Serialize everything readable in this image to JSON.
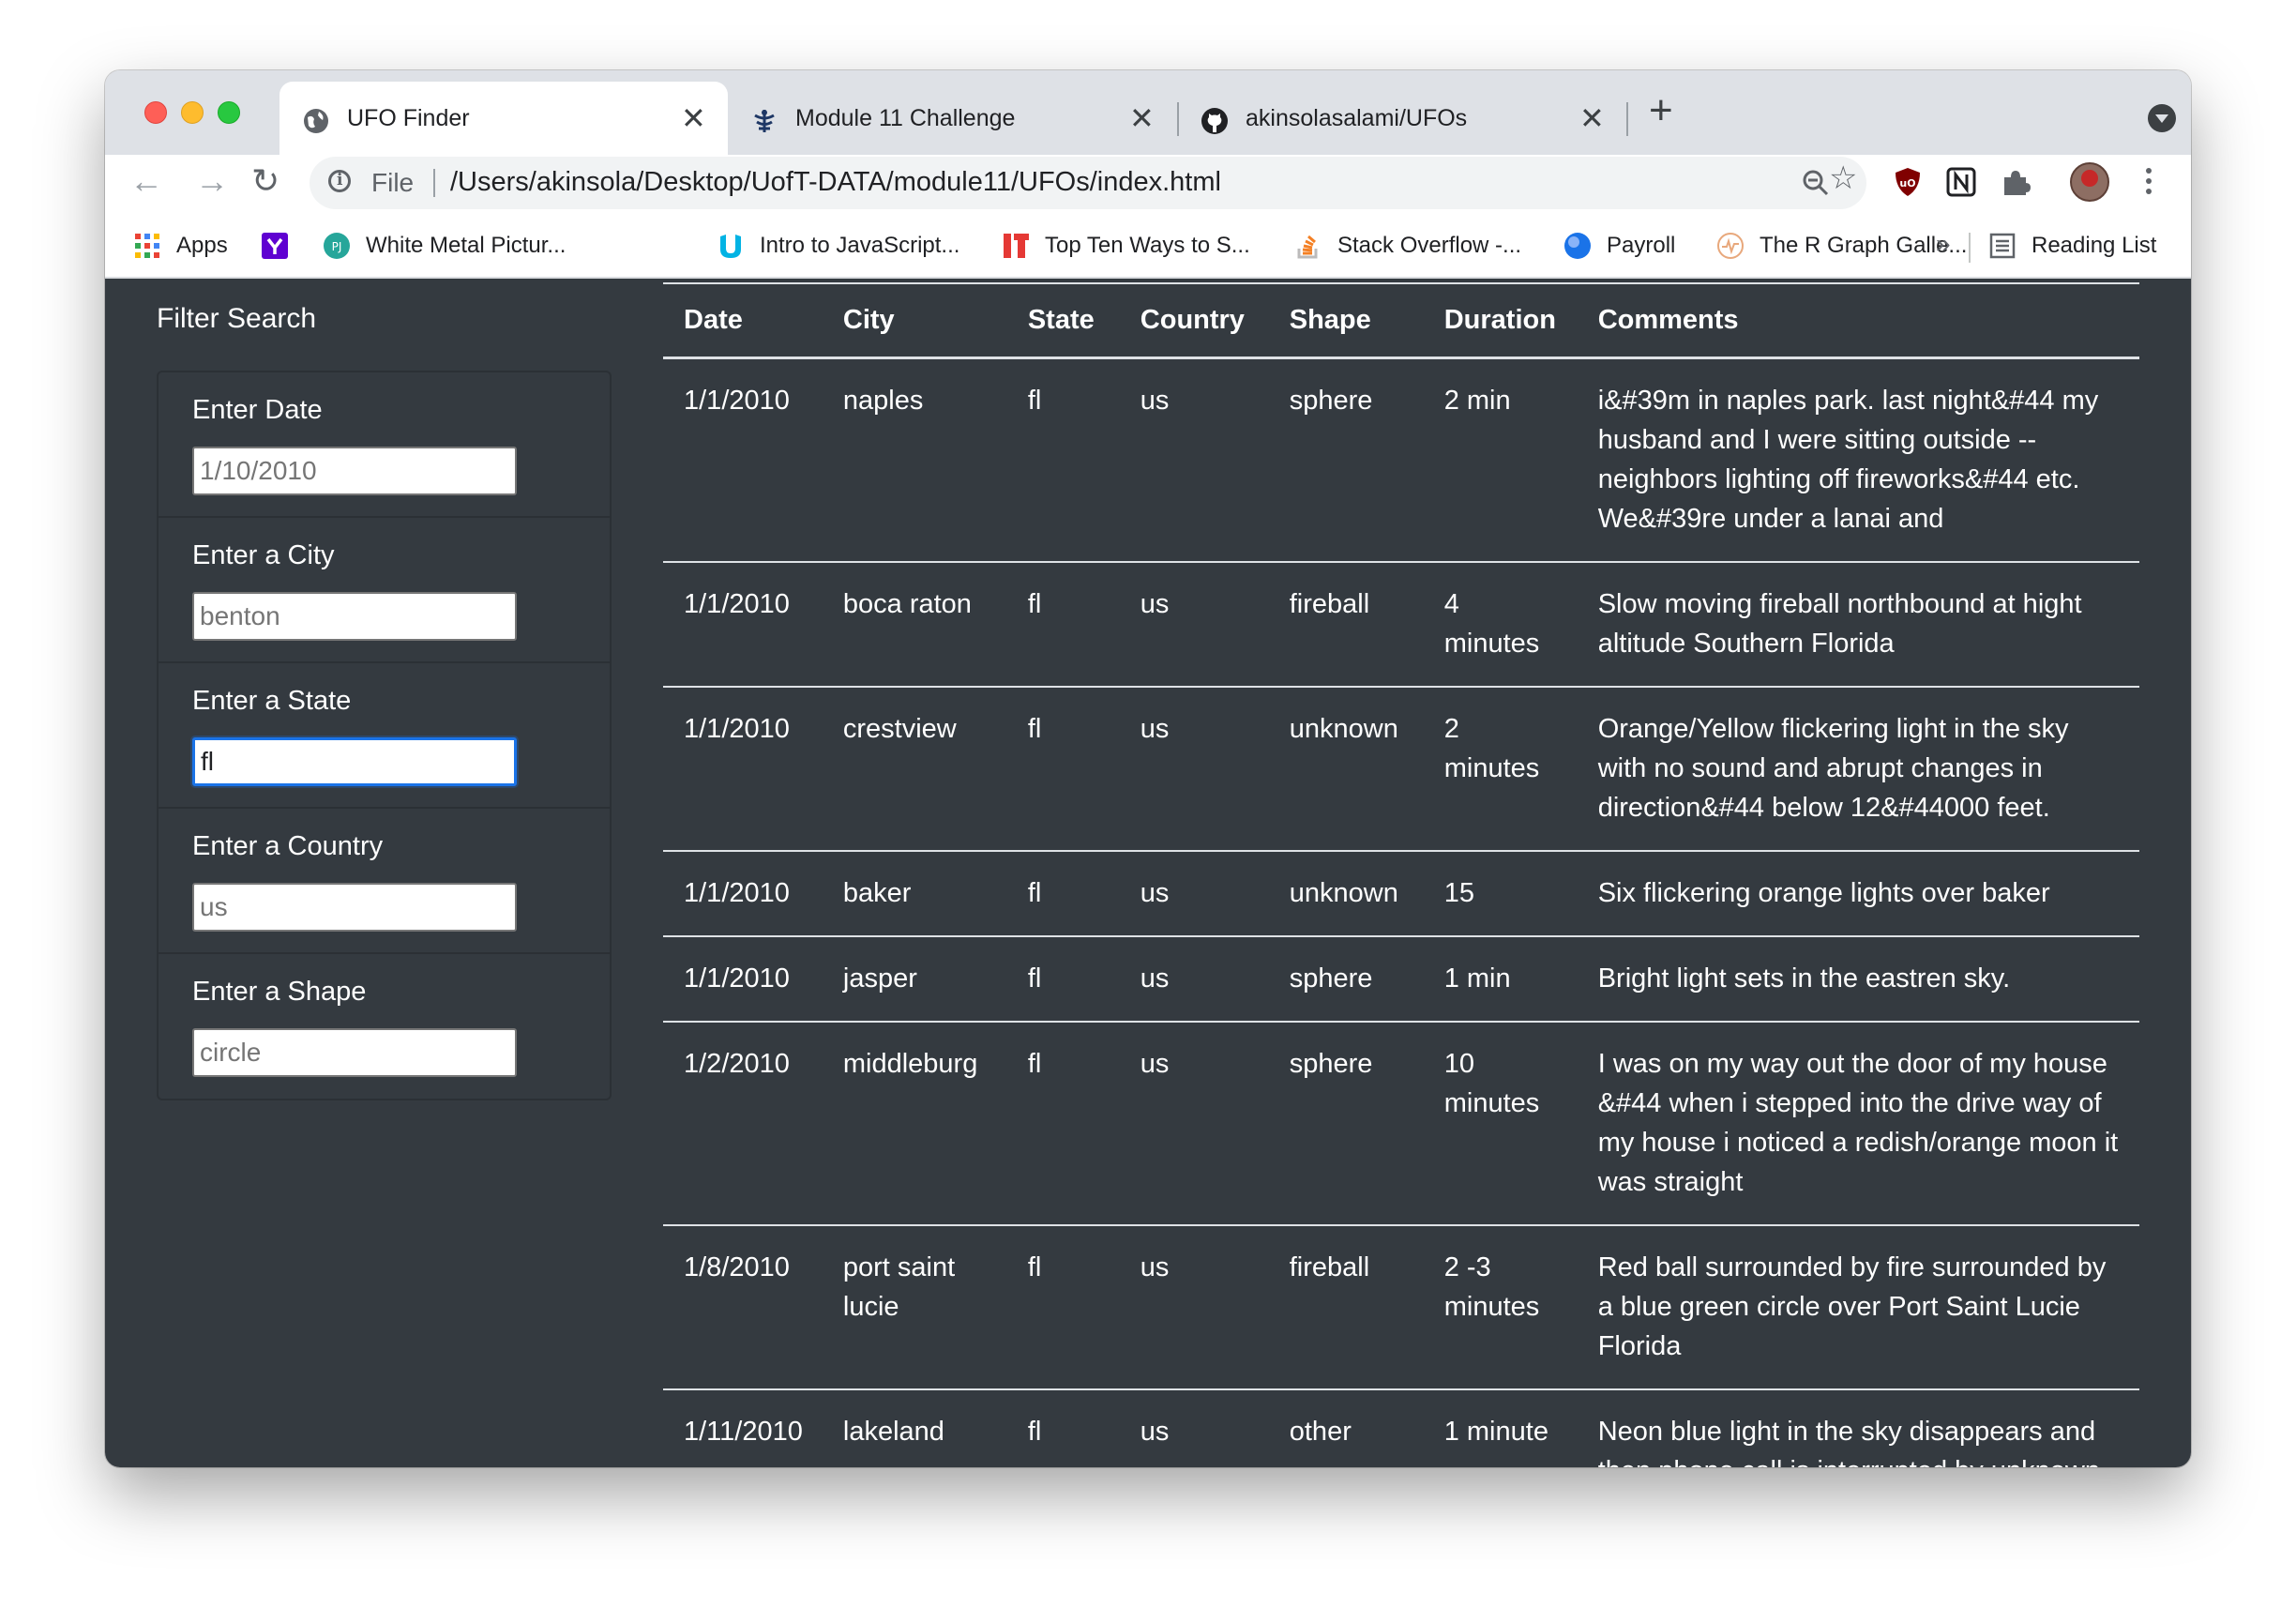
{
  "browser": {
    "tabs": [
      {
        "title": "UFO Finder",
        "icon": "globe-icon",
        "active": true
      },
      {
        "title": "Module 11 Challenge",
        "icon": "uoft-crest-icon",
        "active": false
      },
      {
        "title": "akinsolasalami/UFOs",
        "icon": "github-icon",
        "active": false
      }
    ],
    "address": {
      "scheme_label": "File",
      "url": "/Users/akinsola/Desktop/UofT-DATA/module11/UFOs/index.html"
    },
    "bookmarks": [
      {
        "label": "Apps",
        "icon": "apps-grid-icon"
      },
      {
        "label": "",
        "icon": "yahoo-icon"
      },
      {
        "label": "White Metal Pictur...",
        "icon": "pj-icon"
      },
      {
        "label": "Intro to JavaScript...",
        "icon": "udacity-icon"
      },
      {
        "label": "Top Ten Ways to S...",
        "icon": "it-icon"
      },
      {
        "label": "Stack Overflow -...",
        "icon": "stackoverflow-icon"
      },
      {
        "label": "Payroll",
        "icon": "payroll-icon"
      },
      {
        "label": "The R Graph Galle...",
        "icon": "rgraph-icon"
      }
    ],
    "bookmarks_overflow": "»",
    "reading_list": "Reading List"
  },
  "filters": {
    "title": "Filter Search",
    "items": [
      {
        "label": "Enter Date",
        "value": "",
        "placeholder": "1/10/2010"
      },
      {
        "label": "Enter a City",
        "value": "",
        "placeholder": "benton"
      },
      {
        "label": "Enter a State",
        "value": "fl",
        "placeholder": ""
      },
      {
        "label": "Enter a Country",
        "value": "",
        "placeholder": "us"
      },
      {
        "label": "Enter a Shape",
        "value": "",
        "placeholder": "circle"
      }
    ]
  },
  "table": {
    "headers": [
      "Date",
      "City",
      "State",
      "Country",
      "Shape",
      "Duration",
      "Comments"
    ],
    "rows": [
      [
        "1/1/2010",
        "naples",
        "fl",
        "us",
        "sphere",
        "2 min",
        "i&#39m in naples park. last night&#44 my husband and I were sitting outside -- neighbors lighting off fireworks&#44 etc. We&#39re under a lanai and"
      ],
      [
        "1/1/2010",
        "boca raton",
        "fl",
        "us",
        "fireball",
        "4 minutes",
        "Slow moving fireball northbound at hight altitude Southern Florida"
      ],
      [
        "1/1/2010",
        "crestview",
        "fl",
        "us",
        "unknown",
        "2 minutes",
        "Orange/Yellow flickering light in the sky with no sound and abrupt changes in direction&#44 below 12&#44000 feet."
      ],
      [
        "1/1/2010",
        "baker",
        "fl",
        "us",
        "unknown",
        "15",
        "Six flickering orange lights over baker"
      ],
      [
        "1/1/2010",
        "jasper",
        "fl",
        "us",
        "sphere",
        "1 min",
        "Bright light sets in the eastren sky."
      ],
      [
        "1/2/2010",
        "middleburg",
        "fl",
        "us",
        "sphere",
        "10 minutes",
        "I was on my way out the door of my house &#44 when i stepped into the drive way of my house i noticed a redish/orange moon it was straight"
      ],
      [
        "1/8/2010",
        "port saint lucie",
        "fl",
        "us",
        "fireball",
        "2 -3 minutes",
        "Red ball surrounded by fire surrounded by a blue green circle over Port Saint Lucie Florida"
      ],
      [
        "1/11/2010",
        "lakeland",
        "fl",
        "us",
        "other",
        "1 minute",
        "Neon blue light in the sky disappears and then phone call is interrupted by unknown"
      ]
    ]
  }
}
